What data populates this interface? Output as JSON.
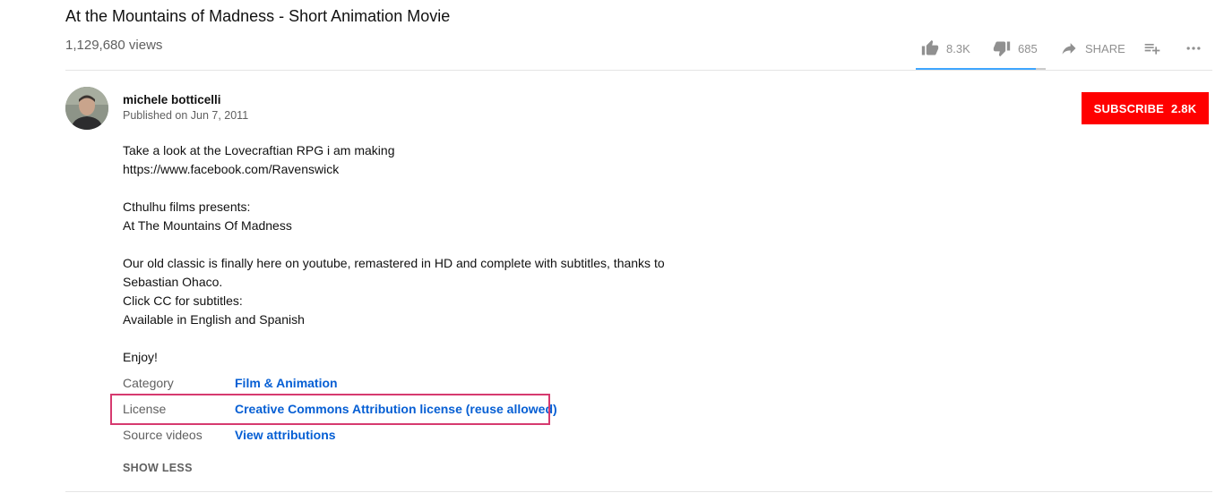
{
  "video": {
    "title": "At the Mountains of Madness - Short Animation Movie",
    "views": "1,129,680 views"
  },
  "actions": {
    "like_count": "8.3K",
    "dislike_count": "685",
    "share_label": "SHARE",
    "like_ratio": 0.924,
    "accent_color": "#3ea6ff"
  },
  "owner": {
    "name": "michele botticelli",
    "published": "Published on Jun 7, 2011",
    "subscribe_label": "SUBSCRIBE",
    "subscriber_count": "2.8K",
    "subscribe_color": "#ff0000"
  },
  "description": {
    "lines": [
      "Take a look at the Lovecraftian RPG i am making",
      "https://www.facebook.com/Ravenswick",
      "",
      "Cthulhu films presents:",
      "At The Mountains Of Madness",
      "",
      "Our old classic is finally here on youtube, remastered in HD and complete with subtitles, thanks to",
      "Sebastian Ohaco.",
      "Click CC for subtitles:",
      "Available in English and Spanish",
      "",
      "Enjoy!"
    ]
  },
  "metadata": {
    "category_label": "Category",
    "category_value": "Film & Animation",
    "license_label": "License",
    "license_value": "Creative Commons Attribution license (reuse allowed)",
    "source_label": "Source videos",
    "source_value": "View attributions",
    "link_color": "#065fd4",
    "highlight_color": "#d63a6f"
  },
  "show_less_label": "SHOW LESS",
  "icons": [
    "like-icon",
    "dislike-icon",
    "share-icon",
    "add-to-playlist-icon",
    "more-icon"
  ]
}
